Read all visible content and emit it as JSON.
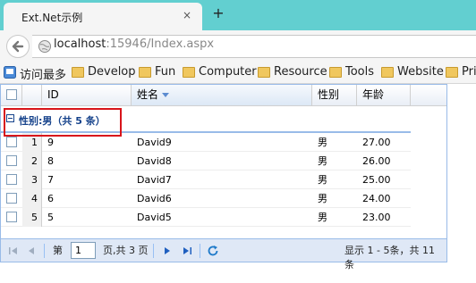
{
  "browser": {
    "tab_title": "Ext.Net示例",
    "tab_close": "×",
    "new_tab": "+",
    "url_host": "localhost",
    "url_rest": ":15946/Index.aspx"
  },
  "bookmarks": [
    {
      "label": "访问最多"
    },
    {
      "label": "Develop"
    },
    {
      "label": "Fun"
    },
    {
      "label": "Computer"
    },
    {
      "label": "Resource"
    },
    {
      "label": "Tools"
    },
    {
      "label": "Website"
    },
    {
      "label": "Pri"
    }
  ],
  "grid": {
    "columns": {
      "id": "ID",
      "name": "姓名",
      "gender": "性别",
      "age": "年龄"
    },
    "group_label": "性别:男（共 5 条）",
    "rows": [
      {
        "num": "1",
        "id": "9",
        "name": "David9",
        "gender": "男",
        "age": "27.00"
      },
      {
        "num": "2",
        "id": "8",
        "name": "David8",
        "gender": "男",
        "age": "26.00"
      },
      {
        "num": "3",
        "id": "7",
        "name": "David7",
        "gender": "男",
        "age": "25.00"
      },
      {
        "num": "4",
        "id": "6",
        "name": "David6",
        "gender": "男",
        "age": "24.00"
      },
      {
        "num": "5",
        "id": "5",
        "name": "David5",
        "gender": "男",
        "age": "23.00"
      }
    ]
  },
  "pager": {
    "page_prefix": "第",
    "page_value": "1",
    "page_suffix": "页,共 3 页",
    "display_info": "显示 1 - 5条，共 11 条"
  }
}
